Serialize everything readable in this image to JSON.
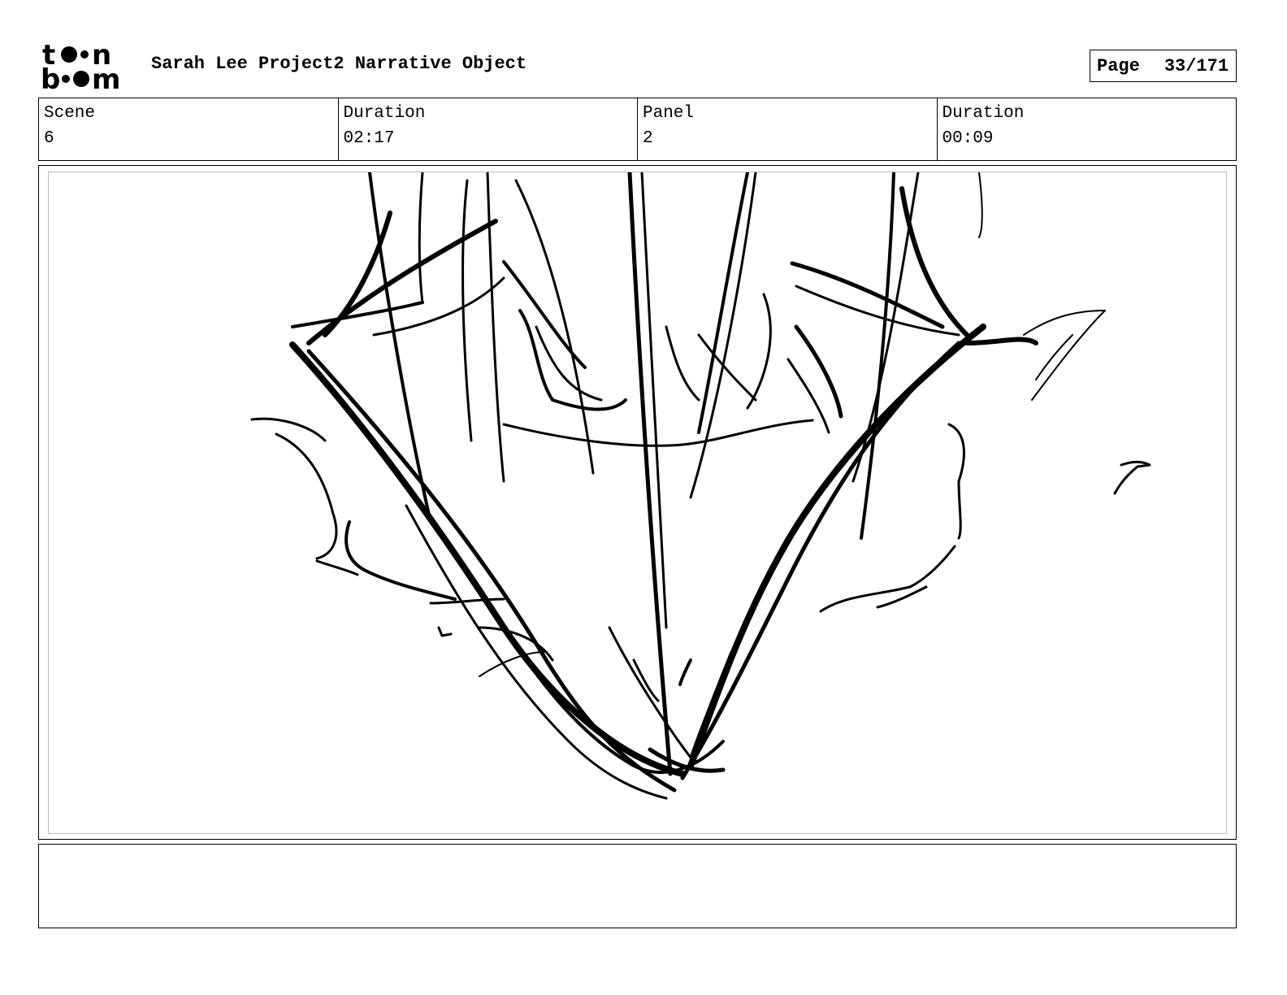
{
  "logo": {
    "line1": "toon",
    "line2": "boom"
  },
  "header": {
    "project_title": "Sarah Lee Project2 Narrative Object",
    "page_label": "Page",
    "page_value": "33/171"
  },
  "info": {
    "scene_label": "Scene",
    "scene_value": "6",
    "scene_duration_label": "Duration",
    "scene_duration_value": "02:17",
    "panel_label": "Panel",
    "panel_value": "2",
    "panel_duration_label": "Duration",
    "panel_duration_value": "00:09"
  },
  "panel_image": {
    "icon": "sketch-face-icon"
  },
  "notes": {
    "text": ""
  }
}
